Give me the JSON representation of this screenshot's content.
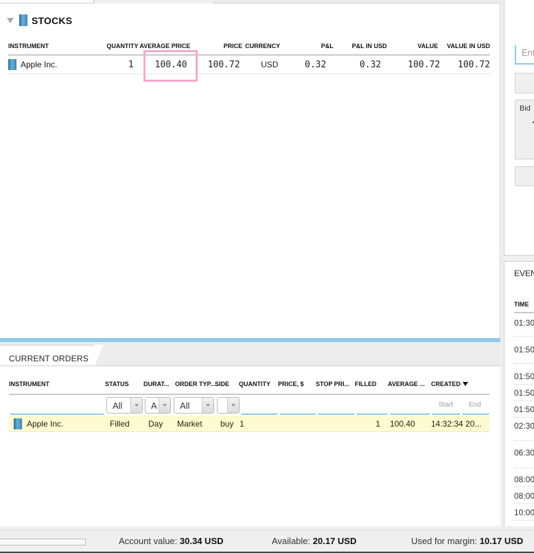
{
  "positions": {
    "section_title": "STOCKS",
    "columns": [
      "INSTRUMENT",
      "QUANTITY",
      "AVERAGE PRICE",
      "PRICE",
      "CURRENCY",
      "P&L",
      "P&L IN USD",
      "VALUE",
      "VALUE IN USD"
    ],
    "rows": [
      {
        "instrument": "Apple Inc.",
        "quantity": "1",
        "average_price": "100.40",
        "price": "100.72",
        "currency": "USD",
        "pl": "0.32",
        "pl_usd": "0.32",
        "value": "100.72",
        "value_usd": "100.72"
      }
    ],
    "highlight_color": "#f6a9cc"
  },
  "orders": {
    "tab_label": "CURRENT ORDERS",
    "columns": [
      "INSTRUMENT",
      "STATUS",
      "DURAT...",
      "ORDER TYP...",
      "SIDE",
      "QUANTITY",
      "PRICE, $",
      "STOP PRI...",
      "FILLED",
      "AVERAGE ...",
      "CREATED"
    ],
    "sort_column": "CREATED",
    "filters": {
      "status": "All",
      "duration": "A",
      "order_type": "All",
      "side": "",
      "created_start": "Start",
      "created_end": "End"
    },
    "rows": [
      {
        "instrument": "Apple Inc.",
        "status": "Filled",
        "duration": "Day",
        "order_type": "Market",
        "side": "buy",
        "quantity": "1",
        "price": "",
        "stop_price": "",
        "filled": "1",
        "average": "100.40",
        "created": "14:32:34 20..."
      }
    ],
    "row_highlight_color": "#fdfbcf"
  },
  "ticket": {
    "input_placeholder": "Ent",
    "bid_label": "Bid"
  },
  "events": {
    "title": "EVEN",
    "time_header": "TIME",
    "times": [
      "01:30",
      "01:50",
      "01:50",
      "01:50",
      "01:50",
      "02:30",
      "06:30",
      "08:00",
      "08:00",
      "10:00"
    ]
  },
  "status_bar": {
    "account_value_label": "Account value:",
    "account_value": "30.34 USD",
    "available_label": "Available:",
    "available": "20.17 USD",
    "margin_label": "Used for margin:",
    "margin": "10.17 USD"
  },
  "accent_color": "#8ccbe8"
}
